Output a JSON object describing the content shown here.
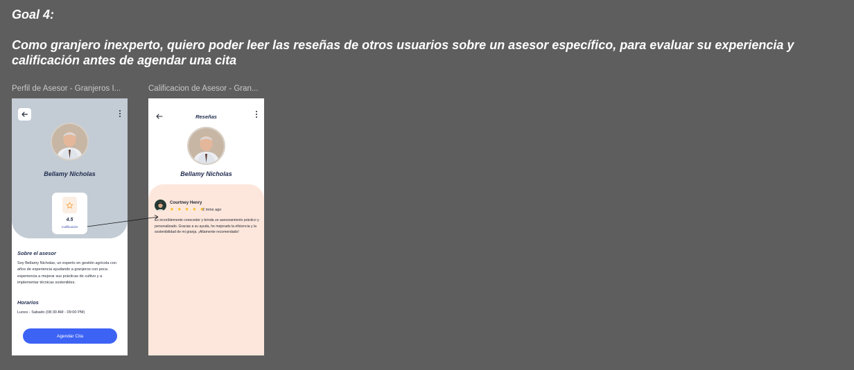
{
  "goal": {
    "title": "Goal 4:",
    "description": "Como granjero inexperto, quiero poder leer las reseñas de otros usuarios sobre un asesor específico, para evaluar su experiencia y calificación antes de agendar una cita"
  },
  "frame1": {
    "label": "Perfil de Asesor - Granjeros I...",
    "advisor_name": "Bellamy Nicholas",
    "rating": {
      "value": "4.5",
      "label": "Calificación",
      "icon": "star-outline-icon"
    },
    "about": {
      "title": "Sobre el asesor",
      "text": "Soy Bellamy Nicholas, un experto en gestión agrícola con años de experiencia ayudando a granjeros con poca experiencia a mejorar sus prácticas de cultivo y a implementar técnicas sostenibles."
    },
    "schedule": {
      "title": "Horarios",
      "text": "Lunes - Sabado (08:30 AM - 09:00 PM)"
    },
    "cta_label": "Agendar Cita"
  },
  "frame2": {
    "label": "Calificacion de Asesor - Gran...",
    "title": "Reseñas",
    "advisor_name": "Bellamy Nicholas",
    "review": {
      "author": "Courtney Henry",
      "stars": "★ ★ ★ ★ ★",
      "rating": 5,
      "time": "2 mins ago",
      "text": "Es increíblemente conocedor y brinda un asesoramiento práctico y personalizado. Gracias a su ayuda, he mejorado la eficiencia y la sostenibilidad de mi granja. ¡Altamente recomendado!"
    }
  },
  "colors": {
    "canvas": "#5e5e5e",
    "hero": "#c3ccd5",
    "accent": "#3d63f5",
    "review_panel": "#fde7dc",
    "star": "#f6b600",
    "text_dark": "#1f2b4d"
  }
}
